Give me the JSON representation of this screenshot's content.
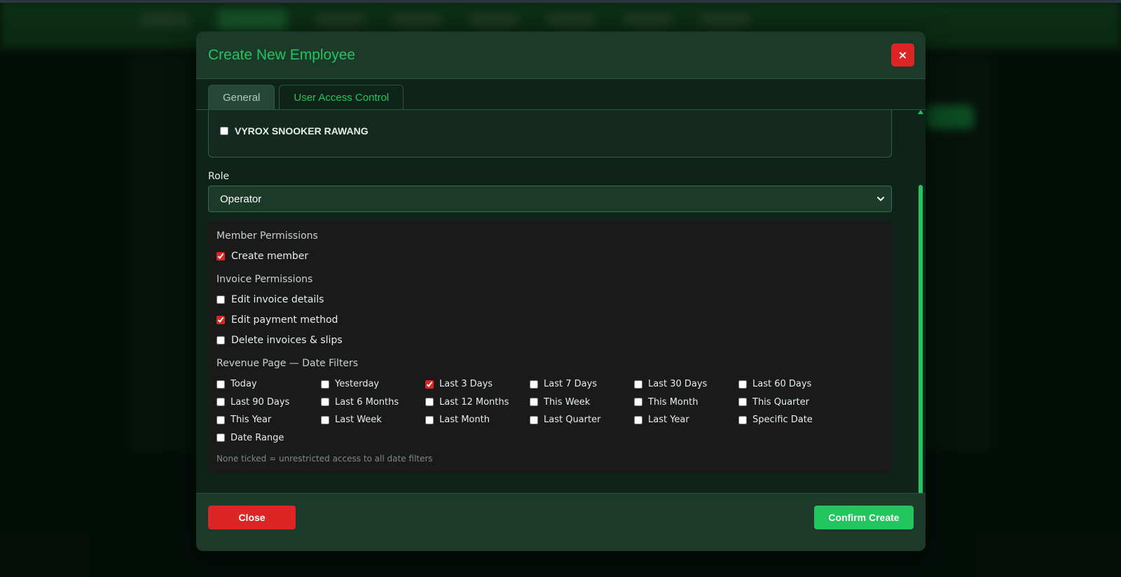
{
  "modal": {
    "title": "Create New Employee",
    "close_icon": "×",
    "tabs": [
      {
        "label": "General",
        "active": false
      },
      {
        "label": "User Access Control",
        "active": true
      }
    ],
    "stores": [
      {
        "label": "VYROX SNOOKER RAWANG",
        "checked": false
      }
    ],
    "role": {
      "label": "Role",
      "selected": "Operator"
    },
    "member_permissions": {
      "title": "Member Permissions",
      "items": [
        {
          "label": "Create member",
          "checked": true
        }
      ]
    },
    "invoice_permissions": {
      "title": "Invoice Permissions",
      "items": [
        {
          "label": "Edit invoice details",
          "checked": false
        },
        {
          "label": "Edit payment method",
          "checked": true
        },
        {
          "label": "Delete invoices & slips",
          "checked": false
        }
      ]
    },
    "date_filters": {
      "title": "Revenue Page — Date Filters",
      "items": [
        {
          "label": "Today",
          "checked": false
        },
        {
          "label": "Yesterday",
          "checked": false
        },
        {
          "label": "Last 3 Days",
          "checked": true
        },
        {
          "label": "Last 7 Days",
          "checked": false
        },
        {
          "label": "Last 30 Days",
          "checked": false
        },
        {
          "label": "Last 60 Days",
          "checked": false
        },
        {
          "label": "Last 90 Days",
          "checked": false
        },
        {
          "label": "Last 6 Months",
          "checked": false
        },
        {
          "label": "Last 12 Months",
          "checked": false
        },
        {
          "label": "This Week",
          "checked": false
        },
        {
          "label": "This Month",
          "checked": false
        },
        {
          "label": "This Quarter",
          "checked": false
        },
        {
          "label": "This Year",
          "checked": false
        },
        {
          "label": "Last Week",
          "checked": false
        },
        {
          "label": "Last Month",
          "checked": false
        },
        {
          "label": "Last Quarter",
          "checked": false
        },
        {
          "label": "Last Year",
          "checked": false
        },
        {
          "label": "Specific Date",
          "checked": false
        },
        {
          "label": "Date Range",
          "checked": false
        }
      ],
      "hint": "None ticked = unrestricted access to all date filters"
    },
    "footer": {
      "close_label": "Close",
      "confirm_label": "Confirm Create"
    }
  },
  "colors": {
    "accent_green": "#22c55e",
    "danger_red": "#dc2626",
    "modal_bg": "#1b3a29"
  }
}
